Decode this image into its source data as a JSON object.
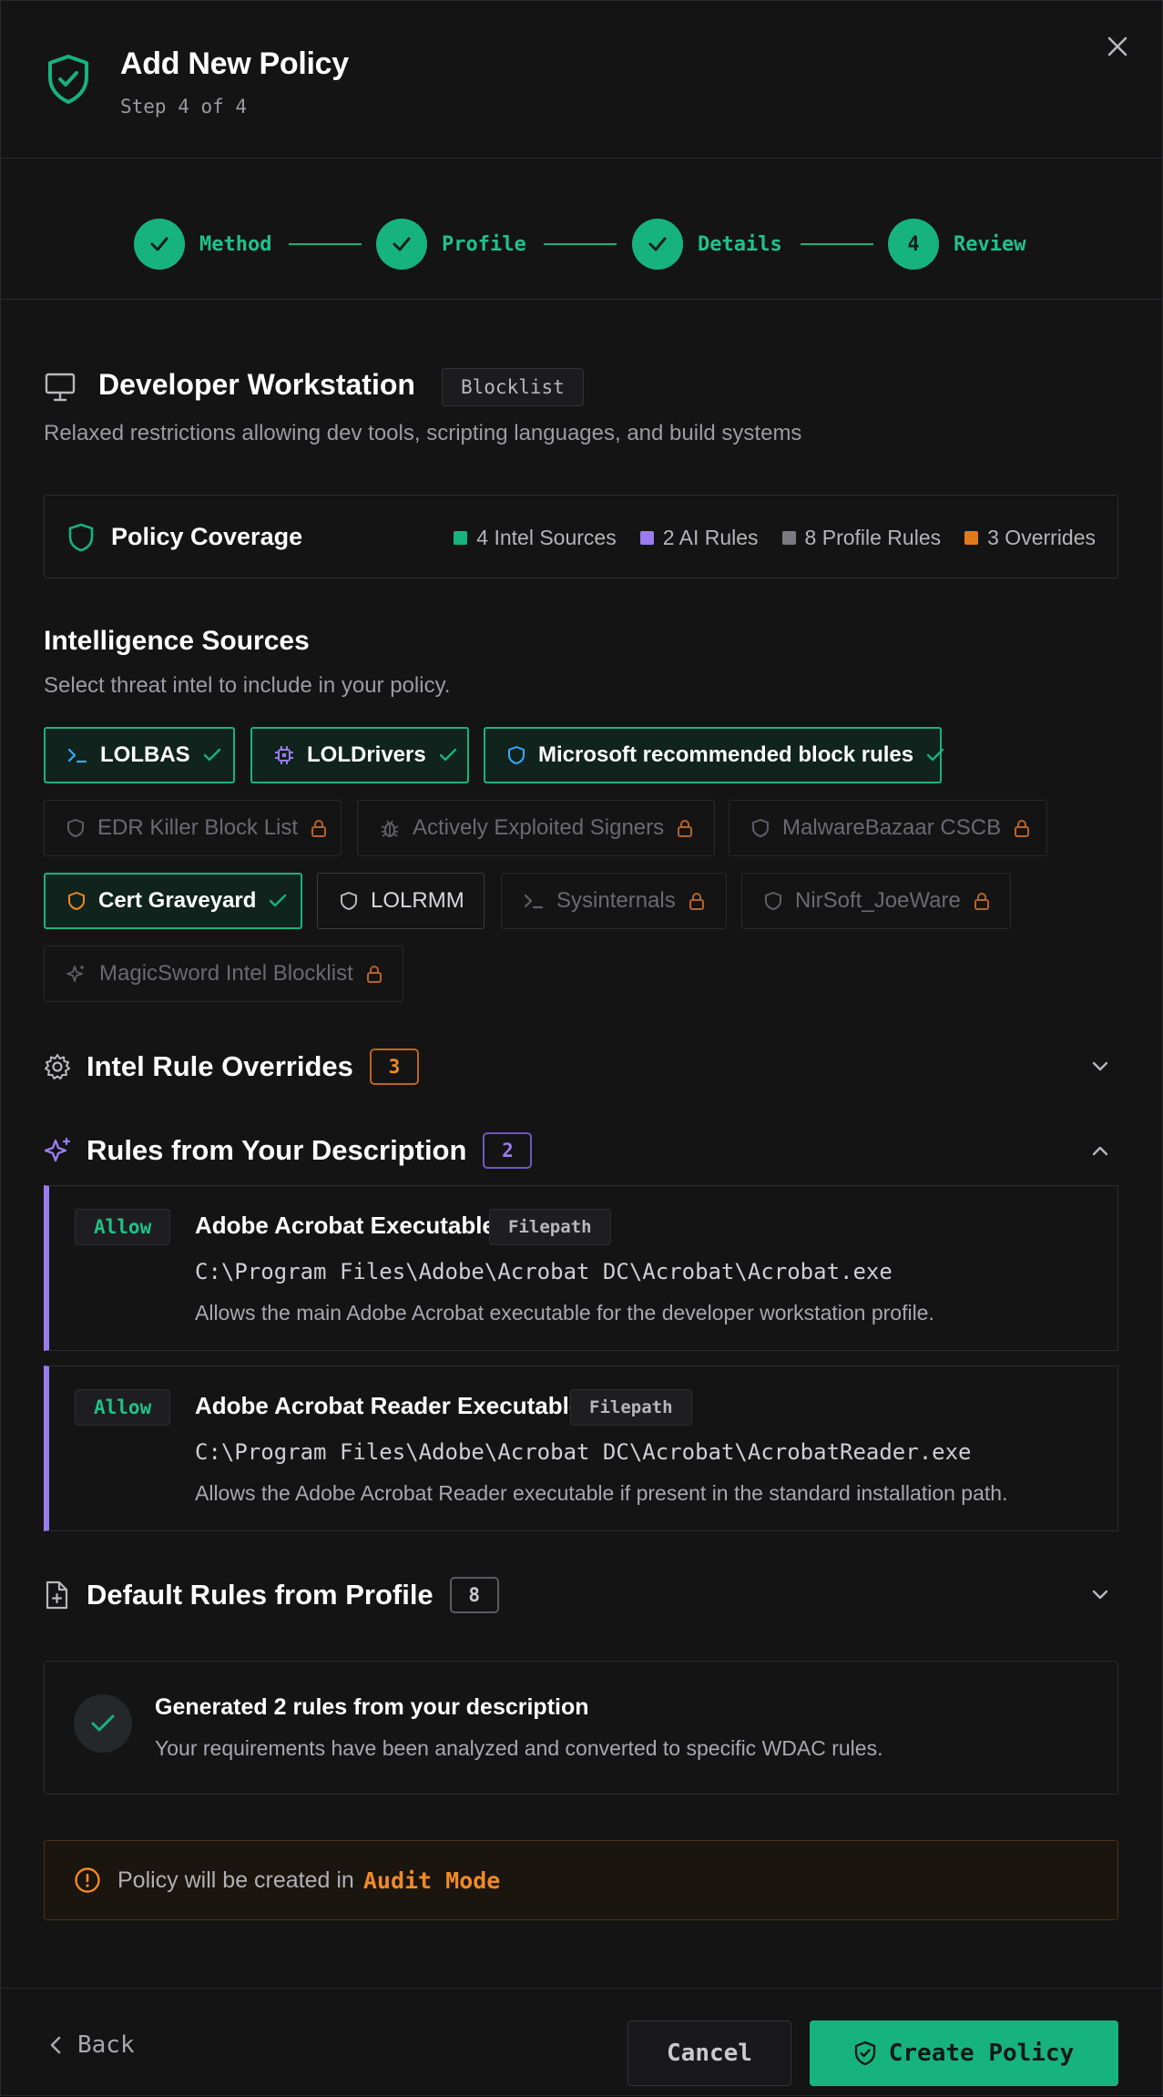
{
  "header": {
    "title": "Add New Policy",
    "subtitle": "Step 4 of 4"
  },
  "stepper": {
    "steps": [
      {
        "label": "Method",
        "state": "complete"
      },
      {
        "label": "Profile",
        "state": "complete"
      },
      {
        "label": "Details",
        "state": "complete"
      },
      {
        "label": "Review",
        "state": "current",
        "number": "4"
      }
    ]
  },
  "profile": {
    "name": "Developer Workstation",
    "badge": "Blocklist",
    "description": "Relaxed restrictions allowing dev tools, scripting languages, and build systems"
  },
  "coverage": {
    "title": "Policy Coverage",
    "legend": [
      {
        "label": "4 Intel Sources",
        "color": "#17b37f"
      },
      {
        "label": "2 AI Rules",
        "color": "#9b7cf0"
      },
      {
        "label": "8 Profile Rules",
        "color": "#7a7a80"
      },
      {
        "label": "3 Overrides",
        "color": "#e07a1c"
      }
    ]
  },
  "sources": {
    "title": "Intelligence Sources",
    "subtitle": "Select threat intel to include in your policy.",
    "chips": [
      {
        "label": "LOLBAS",
        "icon": "terminal-icon",
        "state": "selected"
      },
      {
        "label": "LOLDrivers",
        "icon": "chip-icon",
        "state": "selected"
      },
      {
        "label": "Microsoft recommended block rules",
        "icon": "shield-icon",
        "state": "selected"
      },
      {
        "label": "EDR Killer Block List",
        "icon": "shield-icon",
        "state": "locked"
      },
      {
        "label": "Actively Exploited Signers",
        "icon": "bug-icon",
        "state": "locked"
      },
      {
        "label": "MalwareBazaar CSCB",
        "icon": "shield-icon",
        "state": "locked"
      },
      {
        "label": "Cert Graveyard",
        "icon": "shield-icon",
        "state": "selected"
      },
      {
        "label": "LOLRMM",
        "icon": "shield-icon",
        "state": "available"
      },
      {
        "label": "Sysinternals",
        "icon": "terminal-icon",
        "state": "locked"
      },
      {
        "label": "NirSoft_JoeWare",
        "icon": "shield-icon",
        "state": "locked"
      },
      {
        "label": "MagicSword Intel Blocklist",
        "icon": "sparkle-icon",
        "state": "locked"
      }
    ]
  },
  "overrides": {
    "title": "Intel Rule Overrides",
    "count": "3"
  },
  "ai_rules": {
    "title": "Rules from Your Description",
    "count": "2",
    "rules": [
      {
        "action": "Allow",
        "name": "Adobe Acrobat Executable",
        "type": "Filepath",
        "path": "C:\\Program Files\\Adobe\\Acrobat DC\\Acrobat\\Acrobat.exe",
        "description": "Allows the main Adobe Acrobat executable for the developer workstation profile."
      },
      {
        "action": "Allow",
        "name": "Adobe Acrobat Reader Executable",
        "type": "Filepath",
        "path": "C:\\Program Files\\Adobe\\Acrobat DC\\Acrobat\\AcrobatReader.exe",
        "description": "Allows the Adobe Acrobat Reader executable if present in the standard installation path."
      }
    ]
  },
  "profile_rules": {
    "title": "Default Rules from Profile",
    "count": "8"
  },
  "generated": {
    "title": "Generated 2 rules from your description",
    "description": "Your requirements have been analyzed and converted to specific WDAC rules."
  },
  "audit": {
    "text": "Policy will be created in",
    "mode": "Audit Mode"
  },
  "footer": {
    "back": "Back",
    "cancel": "Cancel",
    "create": "Create Policy"
  },
  "colors": {
    "accent": "#17b37f",
    "ai": "#9b7cf0",
    "warning": "#f08a24"
  }
}
